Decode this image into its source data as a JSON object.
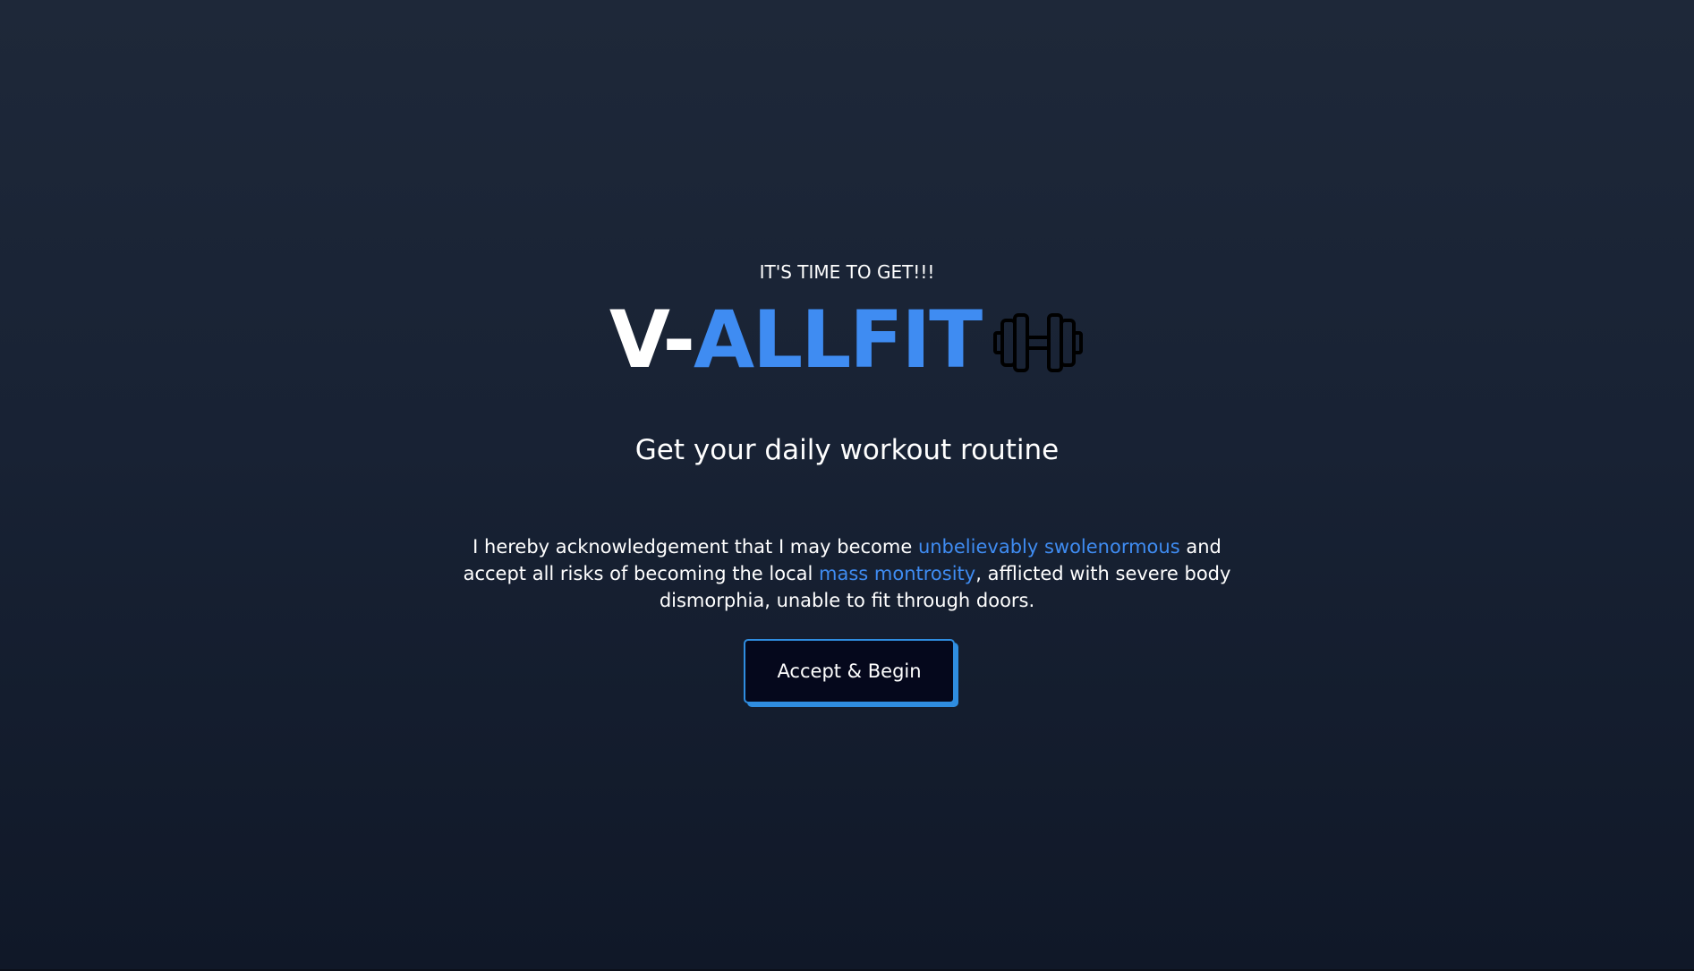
{
  "hero": {
    "pre_title": "IT'S TIME TO GET!!!",
    "brand_prefix": "V-",
    "brand_highlight": "ALLFIT",
    "brand_icon": "dumbbell-icon",
    "subtitle": "Get your daily workout routine",
    "disclaimer": {
      "part1": "I hereby acknowledgement that I may become ",
      "highlight1": "unbelievably swolenormous",
      "part2": " and accept all risks of becoming the local ",
      "highlight2": "mass montrosity",
      "part3": ", afflicted with severe body dismorphia, unable to fit through doors."
    },
    "button_label": "Accept & Begin"
  },
  "colors": {
    "accent": "#3f8cf2",
    "background_top": "#1e2839",
    "background_bottom": "#101828",
    "button_bg": "#05081c",
    "button_border": "#2f8de0"
  }
}
